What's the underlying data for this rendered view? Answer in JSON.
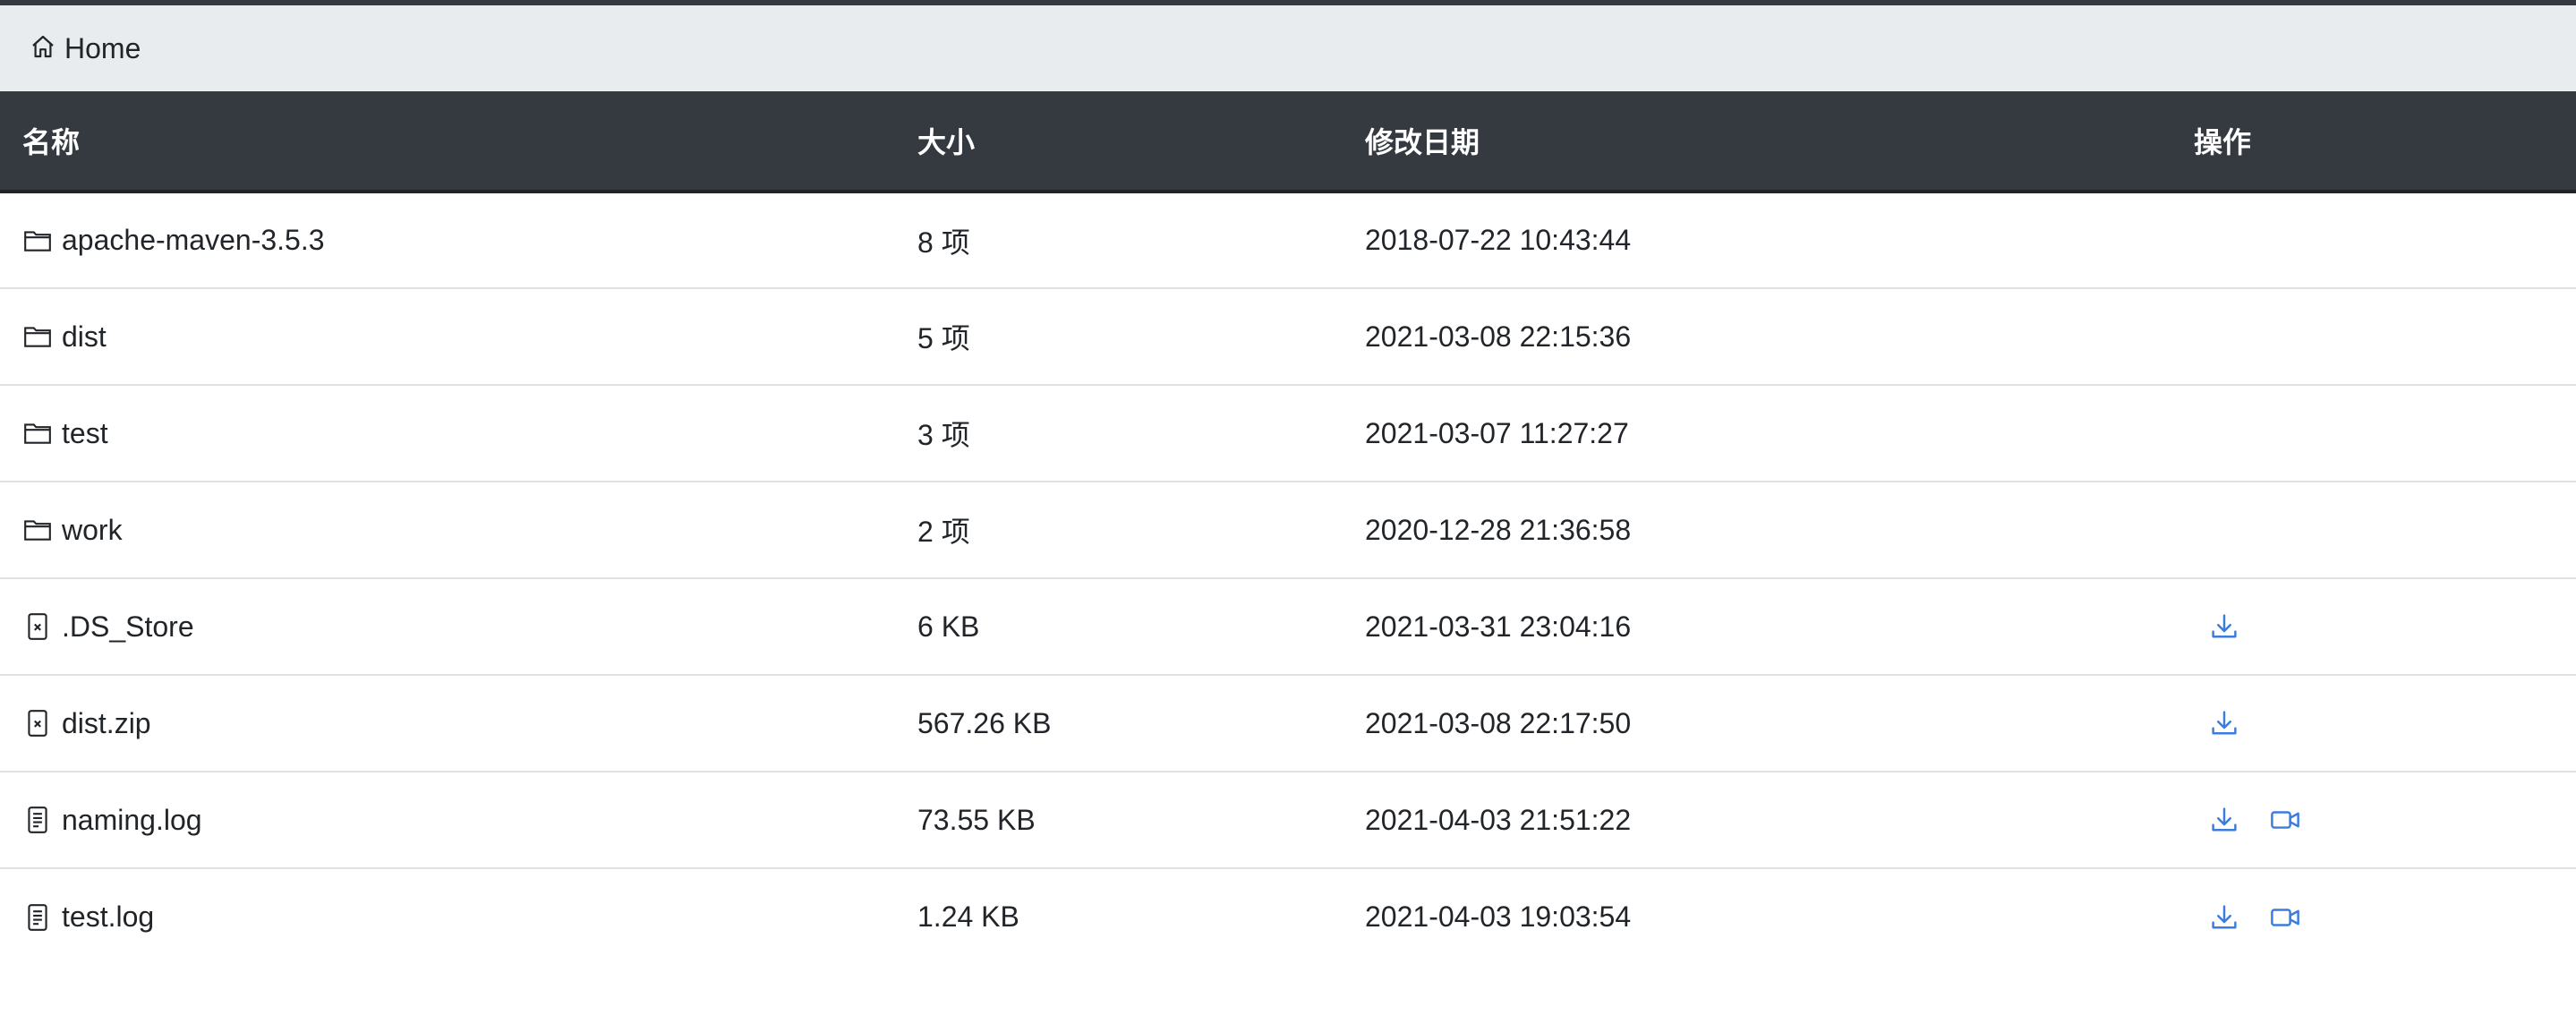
{
  "breadcrumb": {
    "home_label": "Home",
    "home_icon": "home-icon"
  },
  "table": {
    "headers": {
      "name": "名称",
      "size": "大小",
      "modified": "修改日期",
      "actions": "操作"
    },
    "rows": [
      {
        "type": "folder",
        "icon": "folder-icon",
        "name": "apache-maven-3.5.3",
        "size": "8 项",
        "modified": "2018-07-22 10:43:44",
        "download": false,
        "preview": false
      },
      {
        "type": "folder",
        "icon": "folder-icon",
        "name": "dist",
        "size": "5 项",
        "modified": "2021-03-08 22:15:36",
        "download": false,
        "preview": false
      },
      {
        "type": "folder",
        "icon": "folder-icon",
        "name": "test",
        "size": "3 项",
        "modified": "2021-03-07 11:27:27",
        "download": false,
        "preview": false
      },
      {
        "type": "folder",
        "icon": "folder-icon",
        "name": "work",
        "size": "2 项",
        "modified": "2020-12-28 21:36:58",
        "download": false,
        "preview": false
      },
      {
        "type": "binary",
        "icon": "binary-file-icon",
        "name": ".DS_Store",
        "size": "6 KB",
        "modified": "2021-03-31 23:04:16",
        "download": true,
        "preview": false
      },
      {
        "type": "binary",
        "icon": "binary-file-icon",
        "name": "dist.zip",
        "size": "567.26 KB",
        "modified": "2021-03-08 22:17:50",
        "download": true,
        "preview": false
      },
      {
        "type": "text",
        "icon": "text-file-icon",
        "name": "naming.log",
        "size": "73.55 KB",
        "modified": "2021-04-03 21:51:22",
        "download": true,
        "preview": true
      },
      {
        "type": "text",
        "icon": "text-file-icon",
        "name": "test.log",
        "size": "1.24 KB",
        "modified": "2021-04-03 19:03:54",
        "download": true,
        "preview": true
      }
    ]
  },
  "colors": {
    "header_bg": "#343a40",
    "breadcrumb_bg": "#e9ecef",
    "action_icon": "#3b7ddd"
  }
}
